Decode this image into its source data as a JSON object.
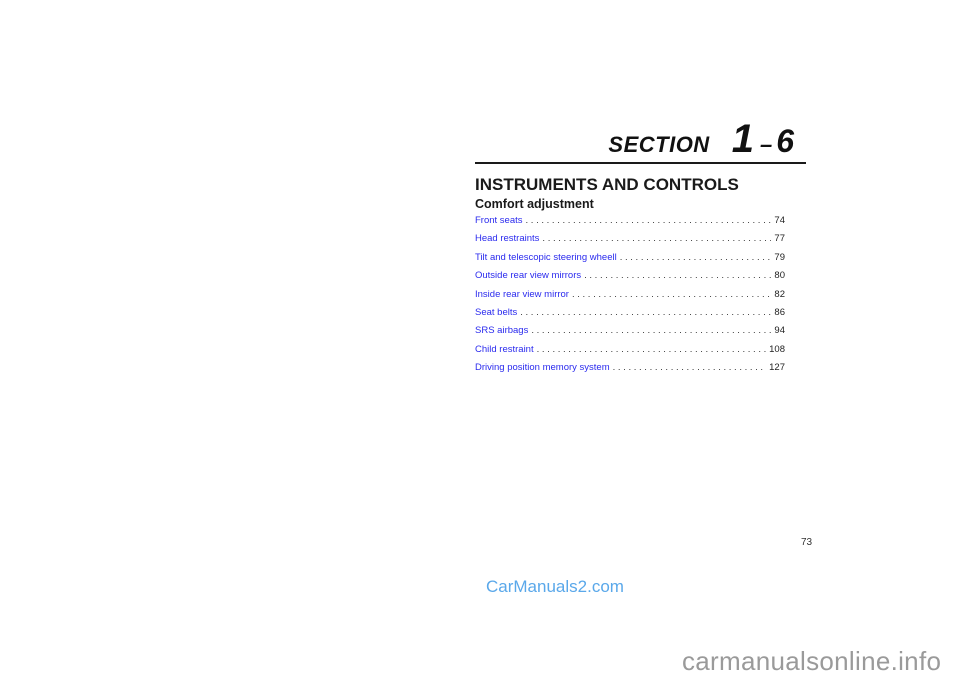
{
  "section": {
    "word": "SECTION",
    "number": "1",
    "dash": "–",
    "sub": "6"
  },
  "title": "INSTRUMENTS AND CONTROLS",
  "subtitle": "Comfort adjustment",
  "toc": [
    {
      "label": "Front seats",
      "page": "74"
    },
    {
      "label": "Head restraints",
      "page": "77"
    },
    {
      "label": "Tilt and telescopic steering wheell",
      "page": "79"
    },
    {
      "label": "Outside rear view mirrors",
      "page": "80"
    },
    {
      "label": "Inside rear view mirror",
      "page": "82"
    },
    {
      "label": "Seat belts",
      "page": "86"
    },
    {
      "label": "SRS airbags",
      "page": "94"
    },
    {
      "label": "Child restraint",
      "page": "108"
    },
    {
      "label": "Driving position memory system",
      "page": "127"
    }
  ],
  "page_number": "73",
  "watermarks": {
    "top": "CarManuals2.com",
    "bottom": "carmanualsonline.info"
  },
  "colors": {
    "link": "#2a2aee",
    "watermark_top": "#5aa8ea",
    "watermark_bottom": "#9a9a9a"
  }
}
